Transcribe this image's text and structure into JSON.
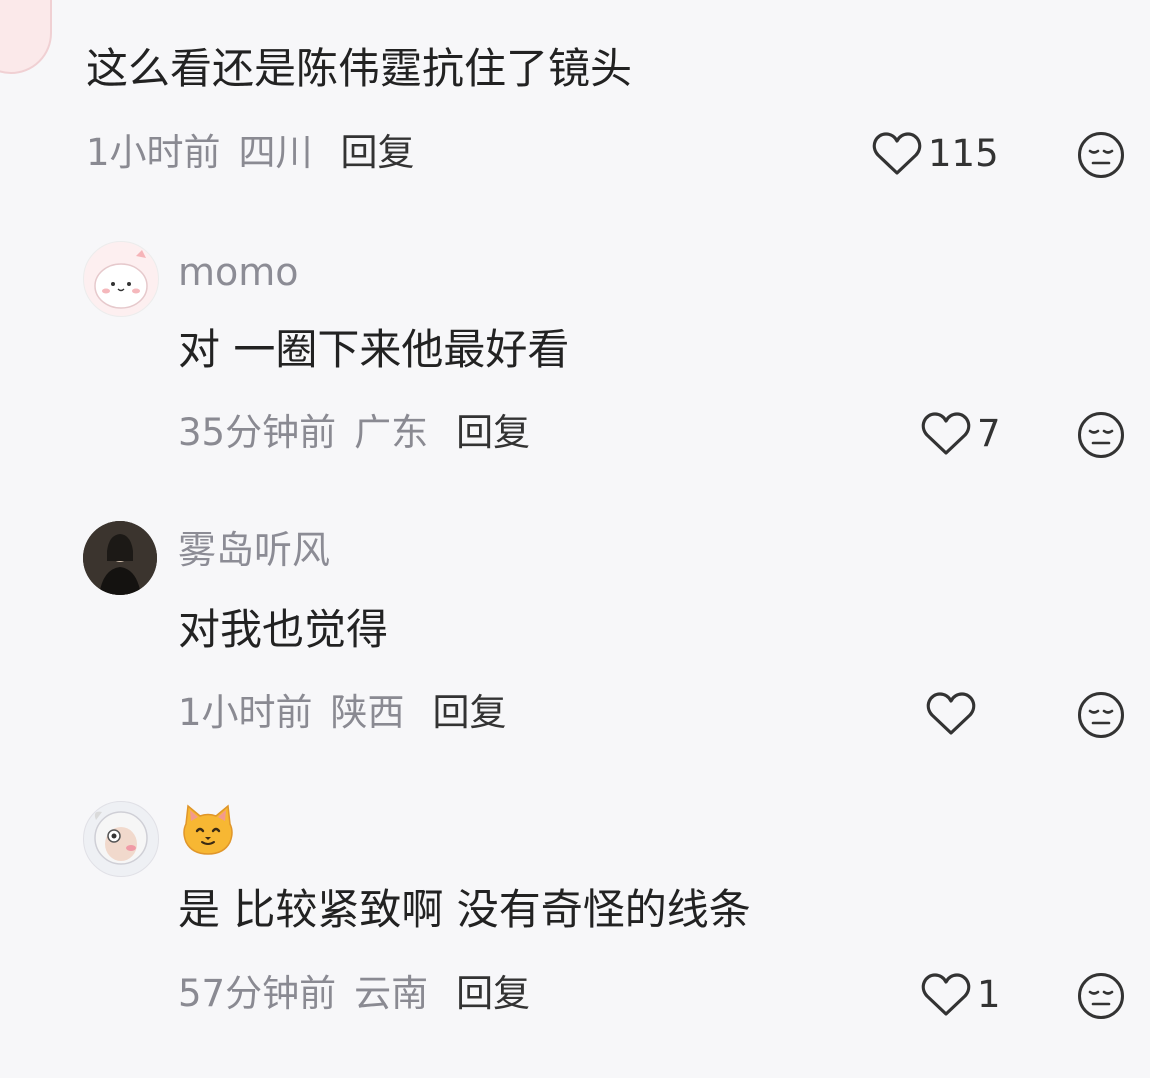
{
  "comment_main": {
    "text": "这么看还是陈伟霆抗住了镜头",
    "time": "1小时前",
    "location": "四川",
    "reply_label": "回复",
    "likes": "115"
  },
  "replies": [
    {
      "username": "momo",
      "text": "对 一圈下来他最好看",
      "time": "35分钟前",
      "location": "广东",
      "reply_label": "回复",
      "likes": "7"
    },
    {
      "username": "雾岛听风",
      "text": "对我也觉得",
      "time": "1小时前",
      "location": "陕西",
      "reply_label": "回复",
      "likes": ""
    },
    {
      "username": "🐱",
      "text": "是 比较紧致啊 没有奇怪的线条",
      "time": "57分钟前",
      "location": "云南",
      "reply_label": "回复",
      "likes": "1"
    }
  ],
  "icons": {
    "like": "heart-outline-icon",
    "reaction": "neutral-face-icon"
  },
  "colors": {
    "background": "#f7f7f9",
    "text": "#222222",
    "meta": "#8a8a92"
  }
}
